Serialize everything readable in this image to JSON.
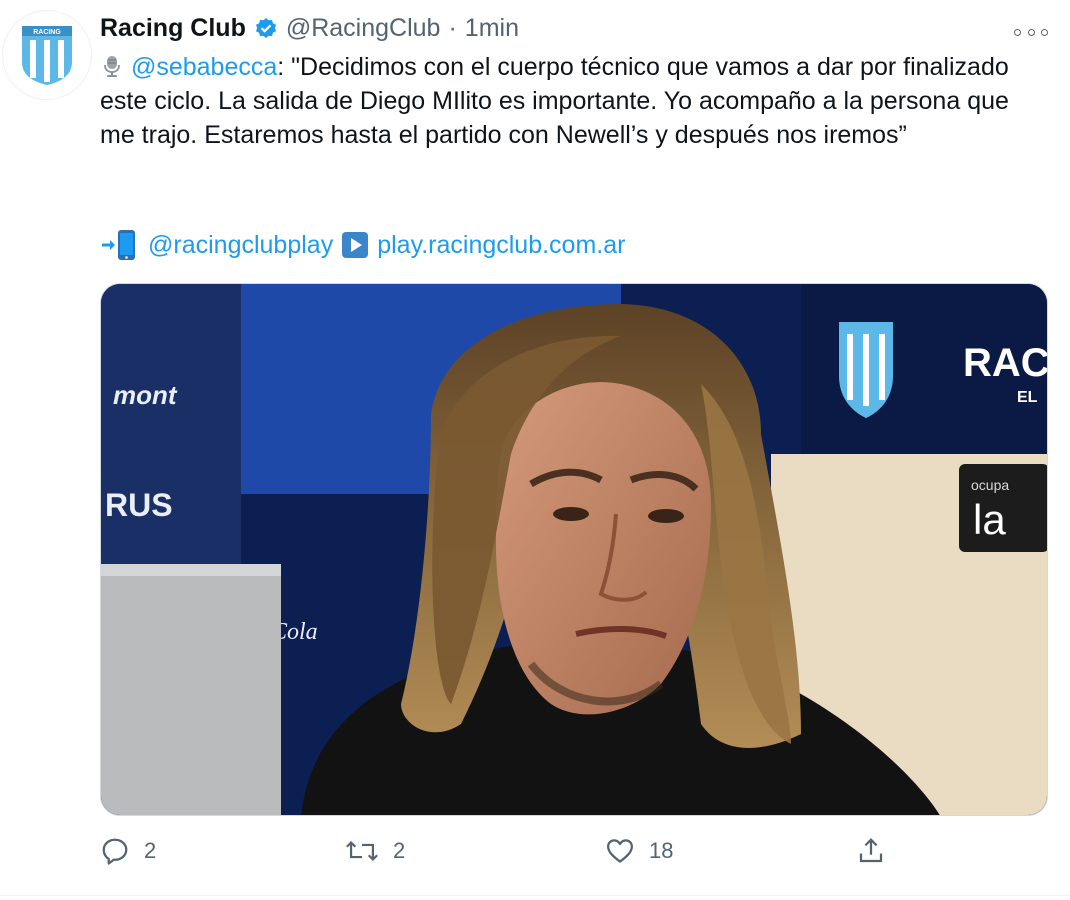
{
  "author": {
    "name": "Racing Club",
    "handle": "@RacingClub",
    "separator": "·",
    "time": "1min",
    "avatar_text": "RACING"
  },
  "tweet": {
    "mic_icon": "microphone-icon",
    "mention": "@sebabecca",
    "body": ": \"Decidimos con el cuerpo técnico que vamos a dar por finalizado este ciclo. La salida de Diego MIlito es importante. Yo acompaño a la persona que me trajo. Estaremos hasta el partido con Newell’s y después nos iremos”",
    "promo_mention": "@racingclubplay",
    "promo_link": "play.racingclub.com.ar"
  },
  "media": {
    "sign_right": "RAC",
    "sign_right_sub": "EL",
    "sign_left_1": "RUS",
    "sign_left_2": "Cola",
    "sign_left_3": "mont",
    "board_text": "la",
    "board_text_top": "ocupa"
  },
  "actions": {
    "reply_count": "2",
    "retweet_count": "2",
    "like_count": "18"
  },
  "colors": {
    "accent": "#1d9bf0",
    "muted": "#536471",
    "racing_blue": "#5cb8e6"
  }
}
